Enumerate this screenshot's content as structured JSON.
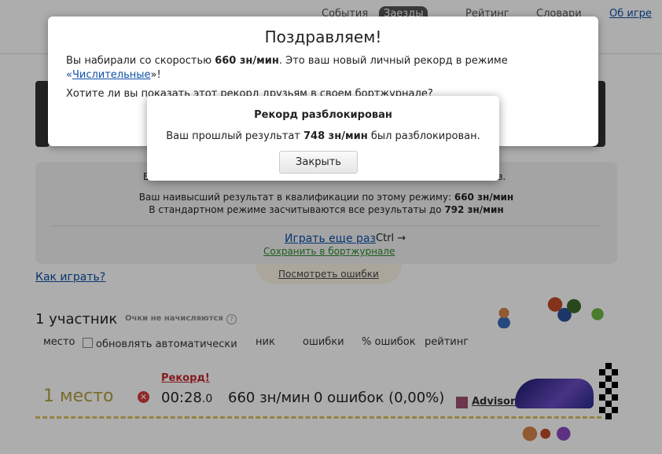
{
  "nav": {
    "items": [
      "События",
      "Заезды",
      "Рейтинг",
      "Словари"
    ],
    "about": "Об игре"
  },
  "results": {
    "line1_left": "В",
    "line1_right": "з.",
    "best_label": "Ваш наивысший результат в квалификации по этому режиму: ",
    "best_value": "660 зн/мин",
    "std_label": "В стандартном режиме засчитываются все результаты до ",
    "std_value": "792 зн/мин",
    "play_again": "Играть еще раз",
    "play_hotkey": "Ctrl →",
    "save_journal": "Сохранить в бортжурнале",
    "view_errors": "Посмотреть ошибки"
  },
  "how_to_play": "Как играть?",
  "participants": {
    "title": "1 участник",
    "not_counted": "Очки не начисляются",
    "help": "?",
    "col_place": "место",
    "col_auto": "обновлять автоматически",
    "col_nick": "ник",
    "col_errors": "ошибки",
    "col_errors_pct": "% ошибок",
    "col_rating": "рейтинг",
    "rows": [
      {
        "record": "Рекорд!",
        "place": "1 место",
        "time_main": "00:28",
        "time_fraction": ".0",
        "speed": "660 зн/мин",
        "errors": "0 ошибок (0,00%)",
        "nick": "Advisor"
      }
    ]
  },
  "dialog_congrats": {
    "title": "Поздравляем!",
    "text_before": "Вы набирали со скоростью ",
    "speed": "660 зн/мин",
    "text_after": ". Это ваш новый личный рекорд в режиме ",
    "mode_open": "«",
    "mode": "Числительные",
    "mode_close": "»!",
    "question": "Хотите ли вы показать этот рекорд друзьям в своем бортжурнале?"
  },
  "dialog_unlock": {
    "title": "Рекорд разблокирован",
    "text_before": "Ваш прошлый результат ",
    "value": "748 зн/мин",
    "text_after": " был разблокирован.",
    "close_label": "Закрыть"
  },
  "colors": {
    "link": "#0d4fa8",
    "record": "#c0292c",
    "place": "#b0a040",
    "save_link": "#2d8a2d"
  }
}
